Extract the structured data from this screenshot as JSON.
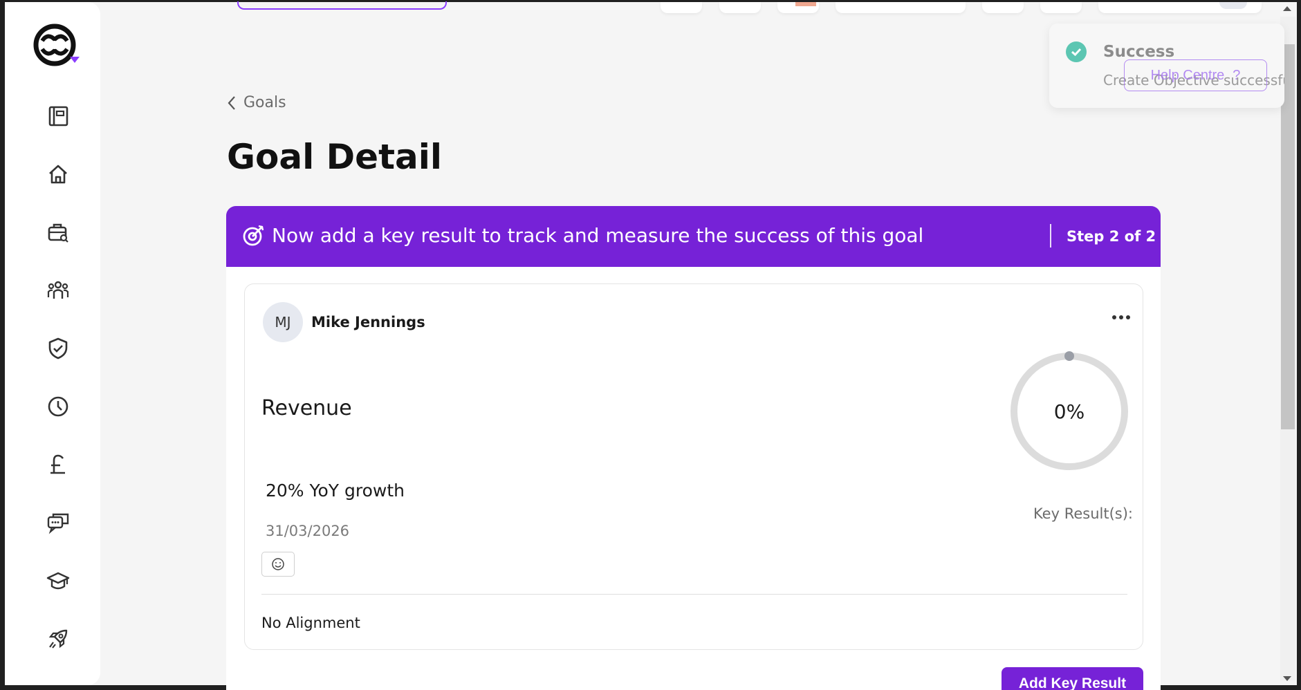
{
  "sidebar": {
    "logo": "logo",
    "items": [
      {
        "icon": "notebook-icon"
      },
      {
        "icon": "home-icon"
      },
      {
        "icon": "briefcase-search-icon"
      },
      {
        "icon": "people-icon"
      },
      {
        "icon": "shield-check-icon"
      },
      {
        "icon": "clock-icon"
      },
      {
        "icon": "pound-icon"
      },
      {
        "icon": "chat-icon"
      },
      {
        "icon": "graduation-cap-icon"
      },
      {
        "icon": "rocket-icon"
      }
    ]
  },
  "toast": {
    "title": "Success",
    "message": "Create Objective successfu",
    "icon": "check-circle-icon"
  },
  "help_centre": {
    "label": "Help Centre",
    "icon_glyph": "?"
  },
  "breadcrumb": {
    "label": "Goals"
  },
  "page": {
    "title": "Goal Detail"
  },
  "banner": {
    "text": "Now add a key result to track and measure the success of this goal",
    "step": "Step 2 of 2",
    "icon": "target-icon"
  },
  "goal": {
    "owner_initials": "MJ",
    "owner_name": "Mike Jennings",
    "name": "Revenue",
    "progress_label": "0%",
    "progress_fraction": 0,
    "description": "20% YoY growth",
    "due_date": "31/03/2026",
    "key_results_label": "Key Result(s):",
    "alignment": "No Alignment"
  },
  "actions": {
    "add_key_result": "Add Key Result"
  },
  "colors": {
    "brand_purple": "#7622d7",
    "success_teal": "#5cc6b2",
    "ring_gray": "#dcdcdc"
  }
}
